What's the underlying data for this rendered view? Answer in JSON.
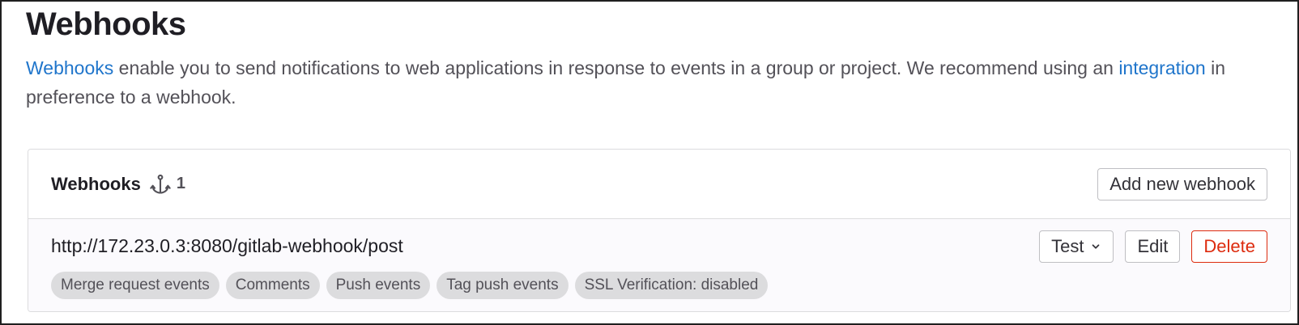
{
  "header": {
    "title": "Webhooks"
  },
  "description": {
    "link1": "Webhooks",
    "text1": " enable you to send notifications to web applications in response to events in a group or project. We recommend using an ",
    "link2": "integration",
    "text2": " in preference to a webhook."
  },
  "card": {
    "title": "Webhooks",
    "count": "1",
    "count_icon": "hook-icon",
    "add_button": "Add new webhook"
  },
  "webhook": {
    "url": "http://172.23.0.3:8080/gitlab-webhook/post",
    "badges": [
      "Merge request events",
      "Comments",
      "Push events",
      "Tag push events",
      "SSL Verification: disabled"
    ],
    "test_label": "Test",
    "edit_label": "Edit",
    "delete_label": "Delete"
  },
  "colors": {
    "link": "#1f75cb",
    "danger": "#dd2b0e"
  }
}
